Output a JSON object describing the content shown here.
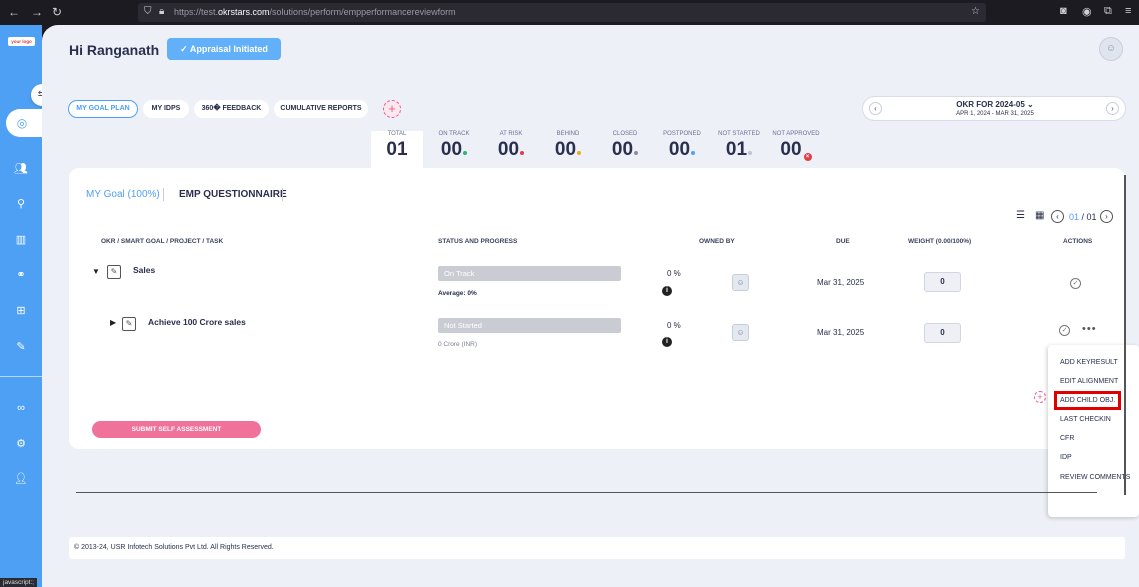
{
  "browser": {
    "url_prefix": "https://test.",
    "url_domain": "okrstars.com",
    "url_path": "/solutions/perform/empperformancereviewform",
    "status": "javascript:;"
  },
  "sidebar": {
    "logo": "your logo"
  },
  "header": {
    "greeting": "Hi Ranganath",
    "appraisal_status": "Appraisal Initiated"
  },
  "pills": [
    {
      "label": "MY GOAL PLAN"
    },
    {
      "label": "MY IDPS"
    },
    {
      "label": "360� FEEDBACK"
    },
    {
      "label": "CUMULATIVE REPORTS"
    }
  ],
  "okr_period": {
    "title": "OKR FOR 2024-05",
    "range": "APR 1, 2024 - MAR 31, 2025"
  },
  "stats": [
    {
      "label": "TOTAL",
      "value": "01"
    },
    {
      "label": "ON TRACK",
      "value": "00",
      "dot": "#2bb673"
    },
    {
      "label": "AT RISK",
      "value": "00",
      "dot": "#e23d49"
    },
    {
      "label": "BEHIND",
      "value": "00",
      "dot": "#f5a623"
    },
    {
      "label": "CLOSED",
      "value": "00",
      "dot": "#8a8fa3"
    },
    {
      "label": "POSTPONED",
      "value": "00",
      "dot": "#4ea0f5"
    },
    {
      "label": "NOT STARTED",
      "value": "01",
      "dot": "#c0c4cf"
    },
    {
      "label": "NOT APPROVED",
      "value": "00"
    }
  ],
  "tabs": {
    "goal": "MY Goal (100%)",
    "questionnaire": "EMP QUESTIONNAIRE"
  },
  "pager": {
    "current": "01",
    "total": "/ 01"
  },
  "table": {
    "headers": {
      "okr": "OKR / SMART GOAL / PROJECT / TASK",
      "status": "STATUS AND PROGRESS",
      "owned": "OWNED BY",
      "due": "DUE",
      "weight": "WEIGHT (0.00/100%)",
      "actions": "ACTIONS"
    },
    "rows": [
      {
        "title": "Sales",
        "status": "On Track",
        "sub": "Average: 0%",
        "pct": "0 %",
        "due": "Mar 31, 2025",
        "weight": "0"
      },
      {
        "title": "Achieve 100 Crore sales",
        "status": "Not Started",
        "sub": "0 Crore (INR)",
        "pct": "0 %",
        "due": "Mar 31, 2025",
        "weight": "0"
      }
    ]
  },
  "submit_label": "SUBMIT SELF ASSESSMENT",
  "menu": [
    "ADD KEYRESULT",
    "EDIT ALIGNMENT",
    "ADD CHILD OBJ.",
    "LAST CHECKIN",
    "CFR",
    "IDP",
    "REVIEW COMMENTS"
  ],
  "footer": "© 2013-24, USR Infotech Solutions Pvt Ltd. All Rights Reserved."
}
